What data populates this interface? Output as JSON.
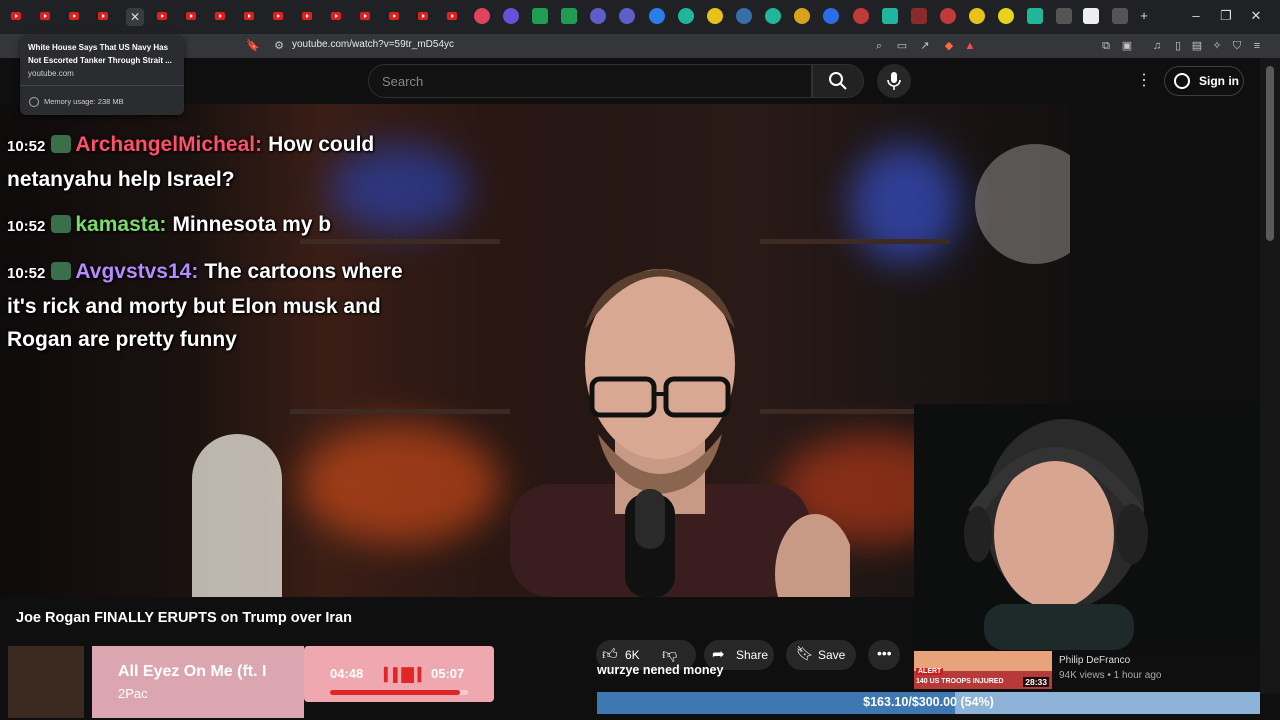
{
  "browser": {
    "url": "youtube.com/watch?v=59tr_mD54yc",
    "tooltip": {
      "title": "White House Says That US Navy Has Not Escorted Tanker Through Strait ...",
      "domain": "youtube.com",
      "memory": "Memory usage: 238 MB"
    },
    "window_controls": [
      "–",
      "❐",
      "✕"
    ],
    "new_tab": "+"
  },
  "youtube": {
    "search_placeholder": "Search",
    "sign_in": "Sign in"
  },
  "chat": [
    {
      "time": "10:52",
      "user": "ArchangelMicheal:",
      "user_color": "#ff4f6a",
      "text": "How could netanyahu help Israel?"
    },
    {
      "time": "10:52",
      "user": "kamasta:",
      "user_color": "#7bdc6a",
      "text": "Minnesota my b"
    },
    {
      "time": "10:52",
      "user": "Avgvstvs14:",
      "user_color": "#b58bff",
      "text": "The cartoons where it's rick and morty but Elon musk and Rogan are pretty funny"
    }
  ],
  "video": {
    "title": "Joe Rogan FINALLY ERUPTS on Trump over Iran",
    "likes": "6K",
    "share": "Share",
    "save": "Save"
  },
  "music": {
    "song": "All Eyez On Me (ft. I",
    "artist": "2Pac",
    "elapsed": "04:48",
    "duration": "05:07",
    "progress": 0.94
  },
  "ticker": "wurzye nened money",
  "donation": {
    "text": "$163.10/$300.00 (54%)",
    "fraction": 0.54
  },
  "recommended": {
    "channel": "Philip DeFranco",
    "meta": "94K views • 1 hour ago",
    "duration": "28:33",
    "thumb_text": "140 US TROOPS INJURED",
    "alert": "ALERT"
  }
}
